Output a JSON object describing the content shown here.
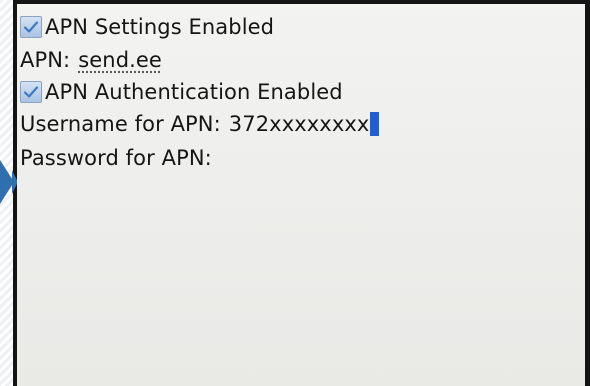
{
  "settings": {
    "apn_settings_enabled": {
      "label": "APN Settings Enabled",
      "checked": true
    },
    "apn": {
      "label": "APN:",
      "value": "send.ee"
    },
    "apn_authentication_enabled": {
      "label": "APN Authentication Enabled",
      "checked": true
    },
    "username": {
      "label": "Username for APN:",
      "value": "372xxxxxxxx"
    },
    "password": {
      "label": "Password for APN:",
      "value": ""
    }
  },
  "icons": {
    "checkbox_checked": "check-icon",
    "side_marker": "arrow-right-icon"
  },
  "colors": {
    "cursor": "#1f5fd1",
    "checkbox_fill": "#a9c3e4",
    "side_arrow": "#2f6fae",
    "bezel": "#141414",
    "screen": "#eeeeec"
  }
}
